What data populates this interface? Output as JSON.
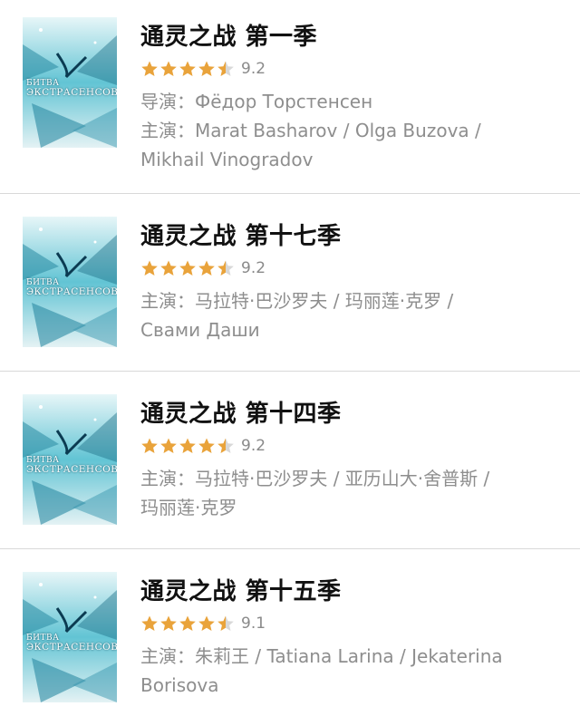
{
  "items": [
    {
      "title": "通灵之战 第一季",
      "rating_value": 4.5,
      "score": "9.2",
      "lines": [
        "导演：Фёдор Торстенсен",
        "主演：Marat Basharov / Olga Buzova /",
        "Mikhail Vinogradov"
      ],
      "poster_text": [
        "БИТВА",
        "ЭКСТРАСЕНСОВ"
      ]
    },
    {
      "title": "通灵之战 第十七季",
      "rating_value": 4.5,
      "score": "9.2",
      "lines": [
        "主演：马拉特·巴沙罗夫 / 玛丽莲·克罗 /",
        "Свами Даши"
      ],
      "poster_text": [
        "БИТВА",
        "ЭКСТРАСЕНСОВ"
      ]
    },
    {
      "title": "通灵之战 第十四季",
      "rating_value": 4.5,
      "score": "9.2",
      "lines": [
        "主演：马拉特·巴沙罗夫 / 亚历山大·舍普斯 /",
        "玛丽莲·克罗"
      ],
      "poster_text": [
        "БИТВА",
        "ЭКСТРАСЕНСОВ"
      ]
    },
    {
      "title": "通灵之战 第十五季",
      "rating_value": 4.5,
      "score": "9.1",
      "lines": [
        "主演：朱莉王 / Tatiana Larina / Jekaterina",
        "Borisova"
      ],
      "poster_text": [
        "БИТВА",
        "ЭКСТРАСЕНСОВ"
      ]
    }
  ],
  "colors": {
    "star": "#e9a33b",
    "star_empty": "#d8d8d8",
    "text_secondary": "#8e8e8e",
    "divider": "#d9d9d9"
  },
  "icons": {
    "star": "star-icon",
    "half_star": "half-star-icon"
  }
}
